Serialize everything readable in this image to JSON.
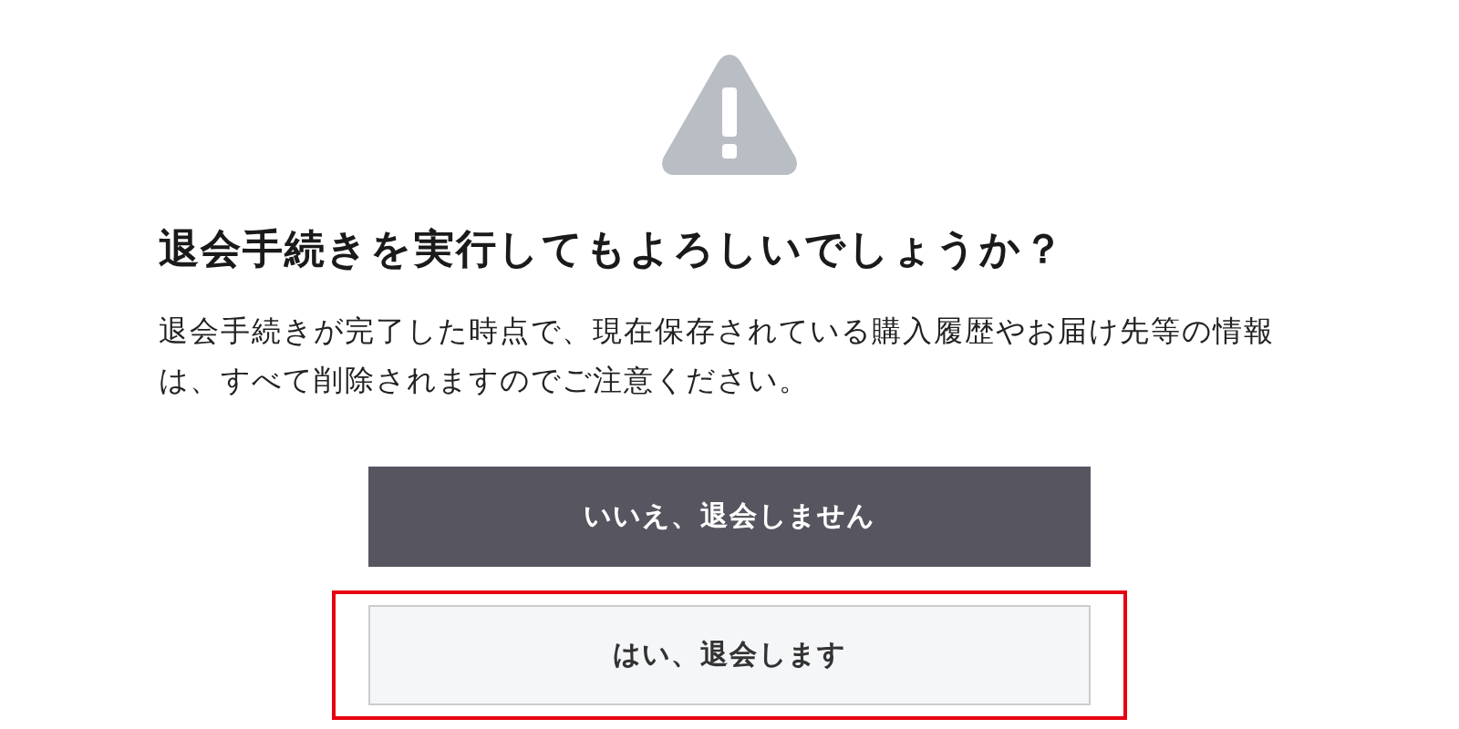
{
  "title": "退会手続きを実行してもよろしいでしょうか？",
  "message": "退会手続きが完了した時点で、現在保存されている購入履歴やお届け先等の情報は、すべて削除されますのでご注意ください。",
  "buttons": [
    {
      "label": "いいえ、退会しません",
      "kind": "primary",
      "highlighted": false
    },
    {
      "label": "はい、退会します",
      "kind": "secondary",
      "highlighted": true
    }
  ]
}
